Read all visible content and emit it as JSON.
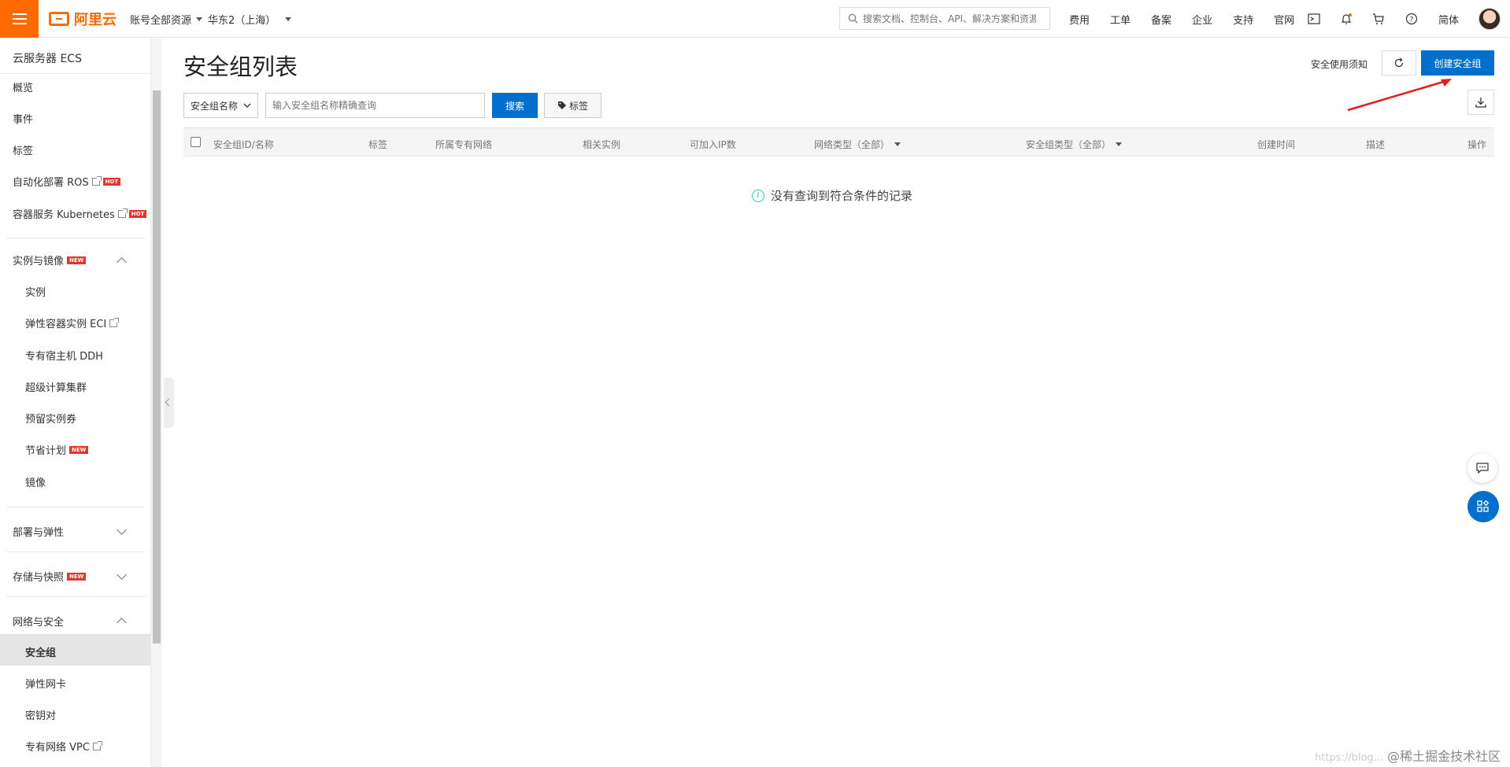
{
  "topbar": {
    "logo_text": "阿里云",
    "account_scope": "账号全部资源",
    "region": "华东2（上海）",
    "search_placeholder": "搜索文档、控制台、API、解决方案和资源",
    "links": [
      "费用",
      "工单",
      "备案",
      "企业",
      "支持",
      "官网"
    ],
    "language": "简体",
    "accent_color": "#ff6a00"
  },
  "sidebar": {
    "title": "云服务器 ECS",
    "items": {
      "overview": "概览",
      "events": "事件",
      "tags": "标签",
      "ros": "自动化部署 ROS",
      "kubernetes": "容器服务 Kubernetes",
      "instances_images": "实例与镜像",
      "instances": "实例",
      "eci": "弹性容器实例 ECI",
      "ddh": "专有宿主机 DDH",
      "super_computing": "超级计算集群",
      "reserved": "预留实例券",
      "savings": "节省计划",
      "images": "镜像",
      "deploy_elastic": "部署与弹性",
      "storage_snapshot": "存储与快照",
      "network_security": "网络与安全",
      "security_group": "安全组",
      "eni": "弹性网卡",
      "keypair": "密钥对",
      "vpc": "专有网络 VPC"
    },
    "badges": {
      "hot": "HOT",
      "new": "NEW"
    }
  },
  "main": {
    "title": "安全组列表",
    "notice_link": "安全使用须知",
    "create_button": "创建安全组",
    "filter_select": "安全组名称",
    "filter_placeholder": "输入安全组名称精确查询",
    "search_button": "搜索",
    "tag_button": "标签",
    "columns": [
      "安全组ID/名称",
      "标签",
      "所属专有网络",
      "相关实例",
      "可加入IP数",
      "网络类型（全部）",
      "安全组类型（全部）",
      "创建时间",
      "描述",
      "操作"
    ],
    "empty_message": "没有查询到符合条件的记录",
    "brand_blue": "#0070cc"
  },
  "watermark": {
    "url": "https://blog...",
    "text": "@稀土掘金技术社区"
  }
}
